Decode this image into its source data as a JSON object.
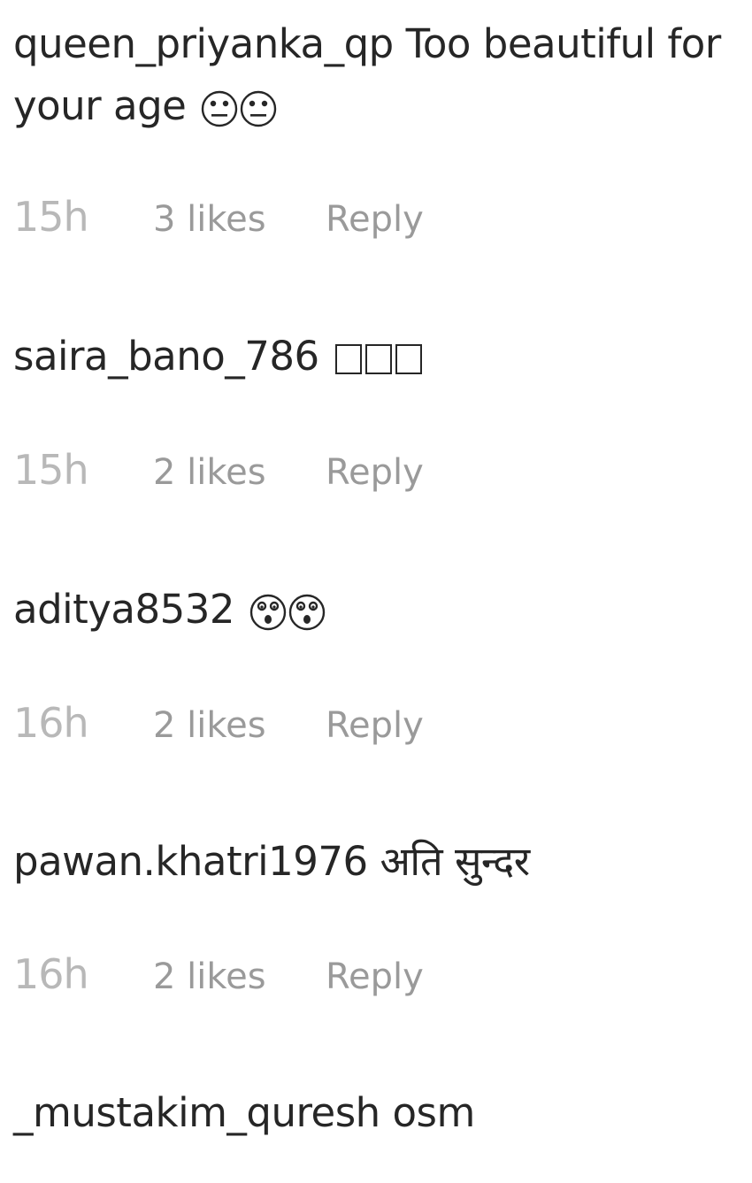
{
  "comments": [
    {
      "username": "queen_priyanka_qp",
      "text": "Too beautiful for your age",
      "emoji": "rolling-eyes-face-icon",
      "time": "15h",
      "likes": "3 likes",
      "reply": "Reply"
    },
    {
      "username": "saira_bano_786",
      "text": "",
      "emoji": "missing-glyph-icon",
      "time": "15h",
      "likes": "2 likes",
      "reply": "Reply"
    },
    {
      "username": "aditya8532",
      "text": "",
      "emoji": "astonished-face-icon",
      "time": "16h",
      "likes": "2 likes",
      "reply": "Reply"
    },
    {
      "username": "pawan.khatri1976",
      "text": "अति सुन्दर",
      "emoji": "",
      "time": "16h",
      "likes": "2 likes",
      "reply": "Reply"
    },
    {
      "username": "_mustakim_quresh",
      "text": "osm"
    }
  ]
}
